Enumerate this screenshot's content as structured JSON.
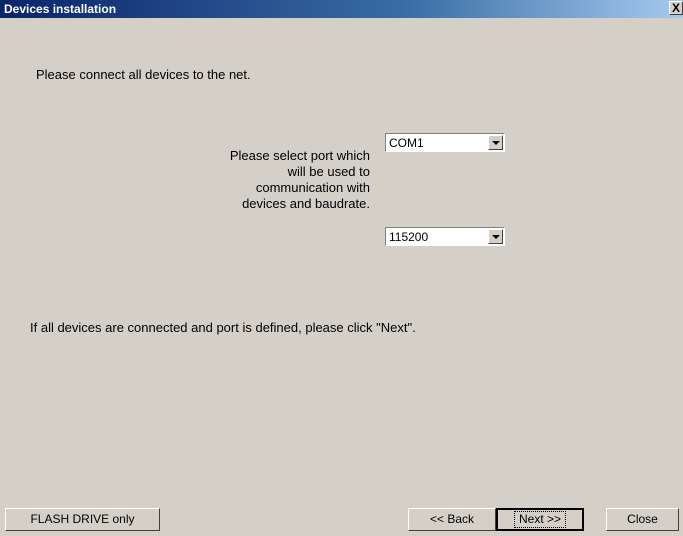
{
  "window": {
    "title": "Devices installation",
    "close_label": "X"
  },
  "content": {
    "intro_text": "Please connect all devices to the net.",
    "port_label_lines": [
      "Please select port which",
      "will be used to",
      "communication with",
      "devices and baudrate."
    ],
    "port_select": {
      "value": "COM1"
    },
    "baud_select": {
      "value": "115200"
    },
    "outro_text": "If all devices are connected and port is defined, please click \"Next\"."
  },
  "buttons": {
    "flash_drive": "FLASH DRIVE only",
    "back": "<< Back",
    "next": "Next >>",
    "close": "Close"
  }
}
